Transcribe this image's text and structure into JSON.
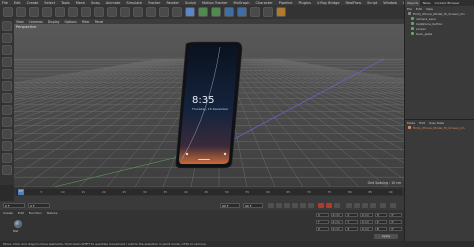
{
  "menubar": {
    "items": [
      "File",
      "Edit",
      "Create",
      "Select",
      "Tools",
      "Mesh",
      "Snap",
      "Animate",
      "Simulate",
      "Tracker",
      "Render",
      "Sculpt",
      "Motion Tracker",
      "MoGraph",
      "Character",
      "Pipeline",
      "Plugins",
      "V-Ray Bridge",
      "RealFlow",
      "Script",
      "Window",
      "Help"
    ],
    "layout_label": "Layout:",
    "layout_value": "Startup (User)"
  },
  "viewport": {
    "menu": [
      "View",
      "Cameras",
      "Display",
      "Options",
      "Filter",
      "Panel"
    ],
    "label": "Perspective",
    "grid_spacing": "Grid Spacing : 10 cm"
  },
  "phone": {
    "time": "8:35",
    "date": "Thursday, 15 December",
    "colors": {
      "body": "#101114",
      "screen": "#0e1a2e",
      "glow": "#c86a3a"
    }
  },
  "object_manager": {
    "tabs": [
      "Objects",
      "Takes",
      "Content Browser",
      "Structure"
    ],
    "menu": [
      "File",
      "Edit",
      "View",
      "Objects",
      "Tags",
      "Bookmarks"
    ],
    "items": [
      {
        "name": "Finity_Phone_Model_Hi_Screen_On",
        "root": true
      },
      {
        "name": "camera_Lens",
        "root": false
      },
      {
        "name": "Cellphone_button",
        "root": false
      },
      {
        "name": "screen",
        "root": false
      },
      {
        "name": "back_plate",
        "root": false
      }
    ]
  },
  "attributes": {
    "menu": [
      "Mode",
      "Edit",
      "User Data"
    ],
    "selected": "Finity_Phone_Model_Hi_Screen_On"
  },
  "timeline": {
    "ticks": [
      "0",
      "5",
      "10",
      "15",
      "20",
      "25",
      "30",
      "35",
      "40",
      "45",
      "50",
      "55",
      "60",
      "65",
      "70",
      "75",
      "80",
      "85",
      "90"
    ],
    "current_frame": "0 F"
  },
  "transport": {
    "start": "0 F",
    "current": "0 F",
    "end": "90 F",
    "end2": "90 F"
  },
  "materials": {
    "menu": [
      "Create",
      "Edit",
      "Function",
      "Texture"
    ],
    "material_name": "Mat"
  },
  "coordinates": {
    "rows": [
      [
        "X",
        "0 cm",
        "X",
        "0 cm",
        "H",
        "0°"
      ],
      [
        "Y",
        "0 cm",
        "Y",
        "0 cm",
        "P",
        "0°"
      ],
      [
        "Z",
        "0 cm",
        "Z",
        "0 cm",
        "B",
        "0°"
      ]
    ],
    "mode_a": "Object (Rel)",
    "mode_b": "Size",
    "apply_label": "Apply"
  },
  "status": {
    "text": "Move: Click and drag to move elements. Hold down SHIFT to quantize movement / add to the selection in point mode, CTRL to remove."
  }
}
